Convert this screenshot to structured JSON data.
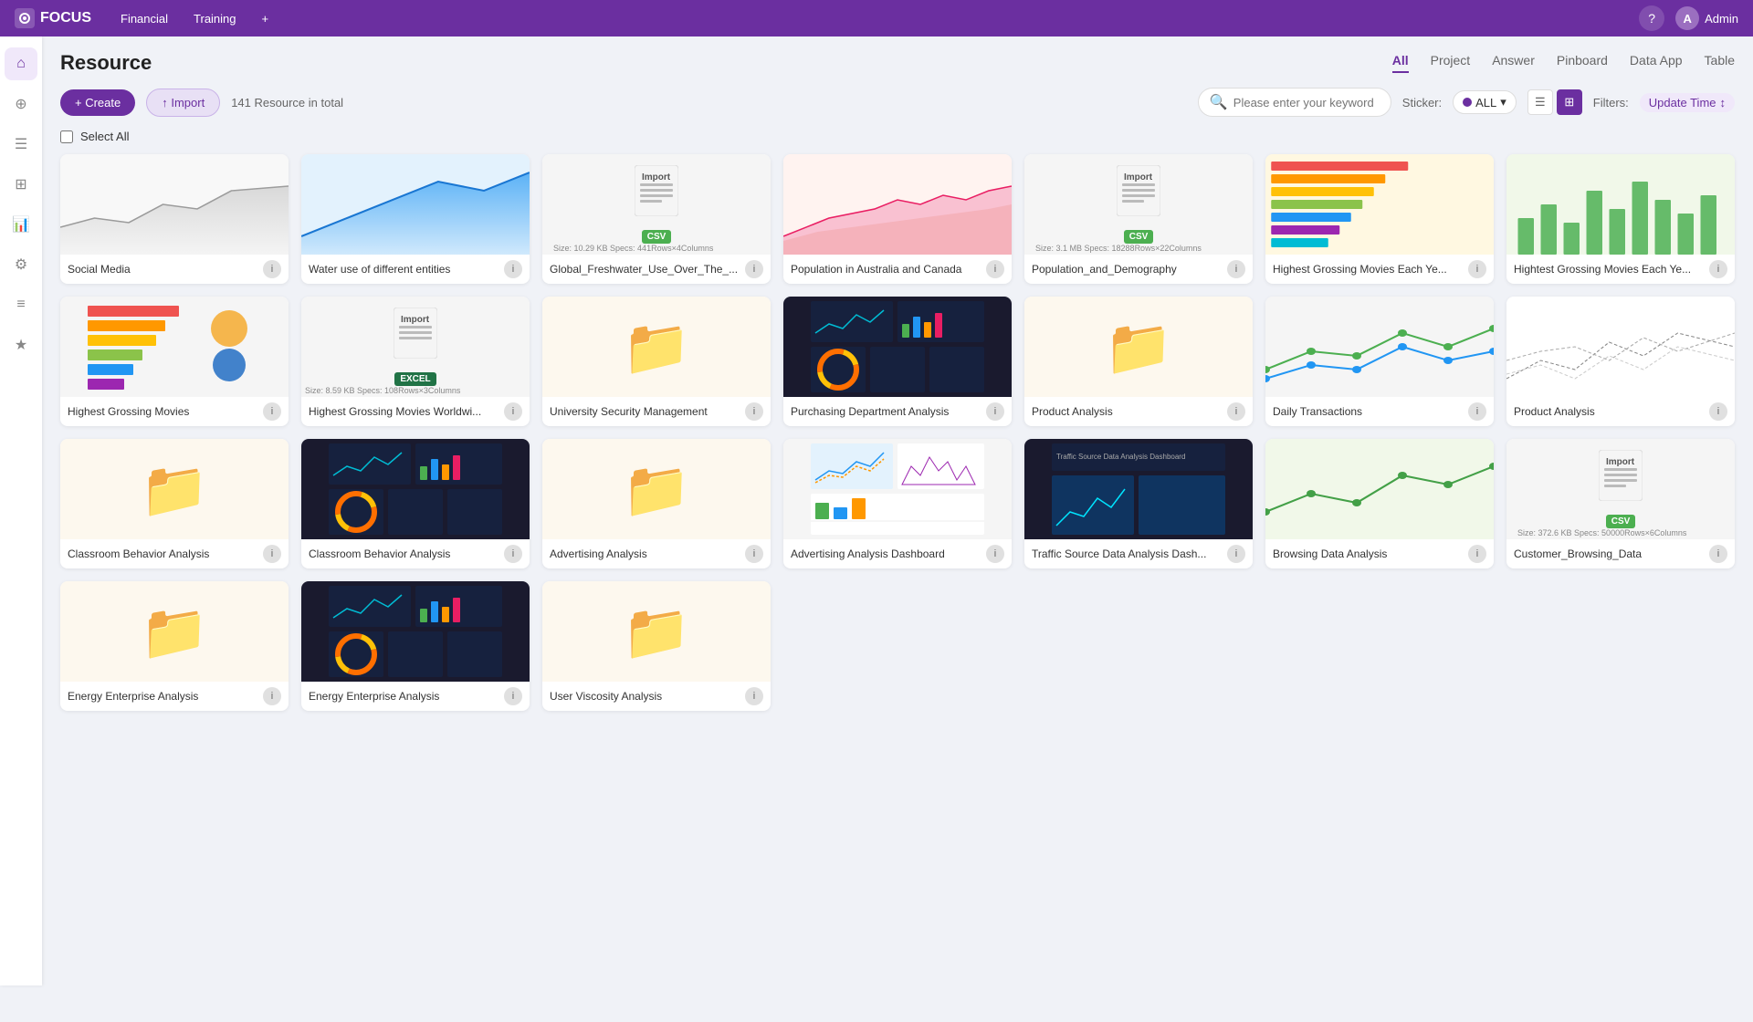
{
  "app": {
    "name": "FOCUS",
    "logo_icon": "focus-logo"
  },
  "topbar": {
    "nav_items": [
      {
        "label": "Financial",
        "id": "financial"
      },
      {
        "label": "Training",
        "id": "training"
      },
      {
        "label": "+",
        "id": "add-tab"
      }
    ],
    "user_name": "Admin",
    "user_initial": "A"
  },
  "sidebar": {
    "icons": [
      {
        "name": "home-icon",
        "symbol": "⌂"
      },
      {
        "name": "search-icon",
        "symbol": "⊕"
      },
      {
        "name": "menu-icon",
        "symbol": "☰"
      },
      {
        "name": "grid-icon",
        "symbol": "⊞"
      },
      {
        "name": "chart-icon",
        "symbol": "📊"
      },
      {
        "name": "settings-icon",
        "symbol": "⚙"
      },
      {
        "name": "list-icon",
        "symbol": "≡"
      },
      {
        "name": "star-icon",
        "symbol": "★"
      }
    ]
  },
  "page": {
    "title": "Resource",
    "tabs": [
      {
        "label": "All",
        "active": true
      },
      {
        "label": "Project"
      },
      {
        "label": "Answer"
      },
      {
        "label": "Pinboard"
      },
      {
        "label": "Data App"
      },
      {
        "label": "Table"
      }
    ],
    "resource_count": "141  Resource in total",
    "create_label": "+ Create",
    "import_label": "↑ Import",
    "search_placeholder": "Please enter your keyword",
    "sticker_label": "Sticker:",
    "sticker_value": "ALL",
    "filters_label": "Filters:",
    "filter_value": "Update Time",
    "select_all_label": "Select All"
  },
  "cards": [
    {
      "id": "social-media",
      "name": "Social Media",
      "type": "chart",
      "thumb_type": "line_area",
      "meta": ""
    },
    {
      "id": "water-use",
      "name": "Water use of different entities",
      "type": "chart",
      "thumb_type": "area_blue",
      "meta": ""
    },
    {
      "id": "global-freshwater",
      "name": "Global_Freshwater_Use_Over_The_...",
      "type": "csv",
      "thumb_type": "csv",
      "meta": "Size: 10.29 KB   Specs:  441Rows×4Columns"
    },
    {
      "id": "population-australia",
      "name": "Population in Australia and Canada",
      "type": "chart",
      "thumb_type": "area_pink",
      "meta": ""
    },
    {
      "id": "population-demography",
      "name": "Population_and_Demography",
      "type": "csv",
      "thumb_type": "csv",
      "meta": "Size: 3.1 MB   Specs:  18288Rows×22Columns"
    },
    {
      "id": "highest-grossing-bar",
      "name": "Highest Grossing Movies Each Ye...",
      "type": "chart",
      "thumb_type": "bar_horizontal_color",
      "meta": ""
    },
    {
      "id": "highest-grossing-ye",
      "name": "Hightest Grossing Movies Each Ye...",
      "type": "chart",
      "thumb_type": "bar_green",
      "meta": ""
    },
    {
      "id": "highest-grossing-movies",
      "name": "Highest Grossing Movies",
      "type": "chart",
      "thumb_type": "bar_horizontal_logo",
      "meta": ""
    },
    {
      "id": "highest-grossing-worldwide",
      "name": "Highest Grossing Movies Worldwi...",
      "type": "excel",
      "thumb_type": "excel",
      "meta": "Size: 8.59 KB   Specs:  108Rows×3Columns"
    },
    {
      "id": "university-security",
      "name": "University Security Management",
      "type": "folder",
      "thumb_type": "folder",
      "meta": ""
    },
    {
      "id": "purchasing-dept",
      "name": "Purchasing Department Analysis",
      "type": "dashboard",
      "thumb_type": "dashboard_dark",
      "meta": ""
    },
    {
      "id": "product-analysis-1",
      "name": "Product Analysis",
      "type": "folder",
      "thumb_type": "folder",
      "meta": ""
    },
    {
      "id": "daily-transactions",
      "name": "Daily Transactions",
      "type": "chart",
      "thumb_type": "line_multi",
      "meta": ""
    },
    {
      "id": "product-analysis-2",
      "name": "Product Analysis",
      "type": "chart",
      "thumb_type": "multi_line_small",
      "meta": ""
    },
    {
      "id": "classroom-behavior-1",
      "name": "Classroom Behavior Analysis",
      "type": "folder",
      "thumb_type": "folder",
      "meta": ""
    },
    {
      "id": "classroom-behavior-2",
      "name": "Classroom Behavior Analysis",
      "type": "dashboard",
      "thumb_type": "dashboard_dark2",
      "meta": ""
    },
    {
      "id": "advertising-analysis",
      "name": "Advertising Analysis",
      "type": "folder",
      "thumb_type": "folder",
      "meta": ""
    },
    {
      "id": "advertising-dashboard",
      "name": "Advertising Analysis Dashboard",
      "type": "dashboard",
      "thumb_type": "dashboard_ad",
      "meta": ""
    },
    {
      "id": "traffic-source",
      "name": "Traffic Source Data Analysis Dash...",
      "type": "dashboard",
      "thumb_type": "dashboard_traffic",
      "meta": ""
    },
    {
      "id": "browsing-data",
      "name": "Browsing Data Analysis",
      "type": "chart",
      "thumb_type": "line_green",
      "meta": ""
    },
    {
      "id": "customer-browsing",
      "name": "Customer_Browsing_Data",
      "type": "csv",
      "thumb_type": "csv",
      "meta": "Size: 372.6 KB   Specs:  50000Rows×6Columns"
    },
    {
      "id": "energy-enterprise-1",
      "name": "Energy Enterprise Analysis",
      "type": "folder",
      "thumb_type": "folder",
      "meta": ""
    },
    {
      "id": "energy-enterprise-2",
      "name": "Energy Enterprise Analysis",
      "type": "dashboard",
      "thumb_type": "dashboard_energy",
      "meta": ""
    },
    {
      "id": "user-viscosity",
      "name": "User Viscosity Analysis",
      "type": "folder",
      "thumb_type": "folder",
      "meta": ""
    }
  ]
}
